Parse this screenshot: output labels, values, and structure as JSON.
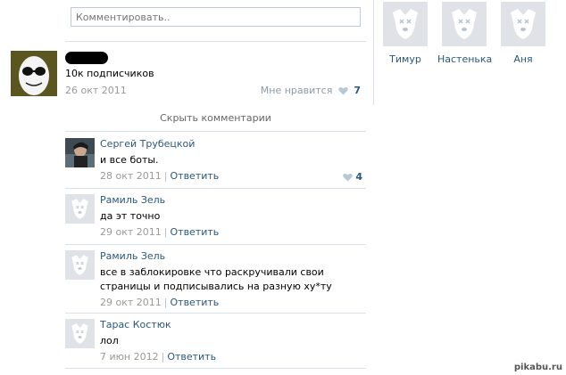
{
  "composer": {
    "placeholder": "Комментировать.."
  },
  "friends": [
    {
      "name": "Тимур"
    },
    {
      "name": "Настенька"
    },
    {
      "name": "Аня"
    }
  ],
  "post": {
    "text": "10к подписчиков",
    "date": "26 окт 2011",
    "like_label": "Мне нравится",
    "like_count": "7"
  },
  "hide_comments": "Скрыть комментарии",
  "comments": [
    {
      "author": "Сергей Трубецкой",
      "text": "и все боты.",
      "date": "28 окт 2011",
      "reply": "Ответить",
      "likes": "4"
    },
    {
      "author": "Рамиль Зель",
      "text": "да эт точно",
      "date": "29 окт 2011",
      "reply": "Ответить"
    },
    {
      "author": "Рамиль Зель",
      "text": "все в заблокировке что раскручивали свои страницы и подписывались на разную ху*ту",
      "date": "29 окт 2011",
      "reply": "Ответить"
    },
    {
      "author": "Тарас Костюк",
      "text": "лол",
      "date": "7 июн 2012",
      "reply": "Ответить"
    }
  ],
  "watermark": "pikabu.ru",
  "colors": {
    "link": "#2b587a",
    "divider": "#dae1e8",
    "muted": "#999999",
    "deactivated_avatar": "#dfe3e8"
  }
}
